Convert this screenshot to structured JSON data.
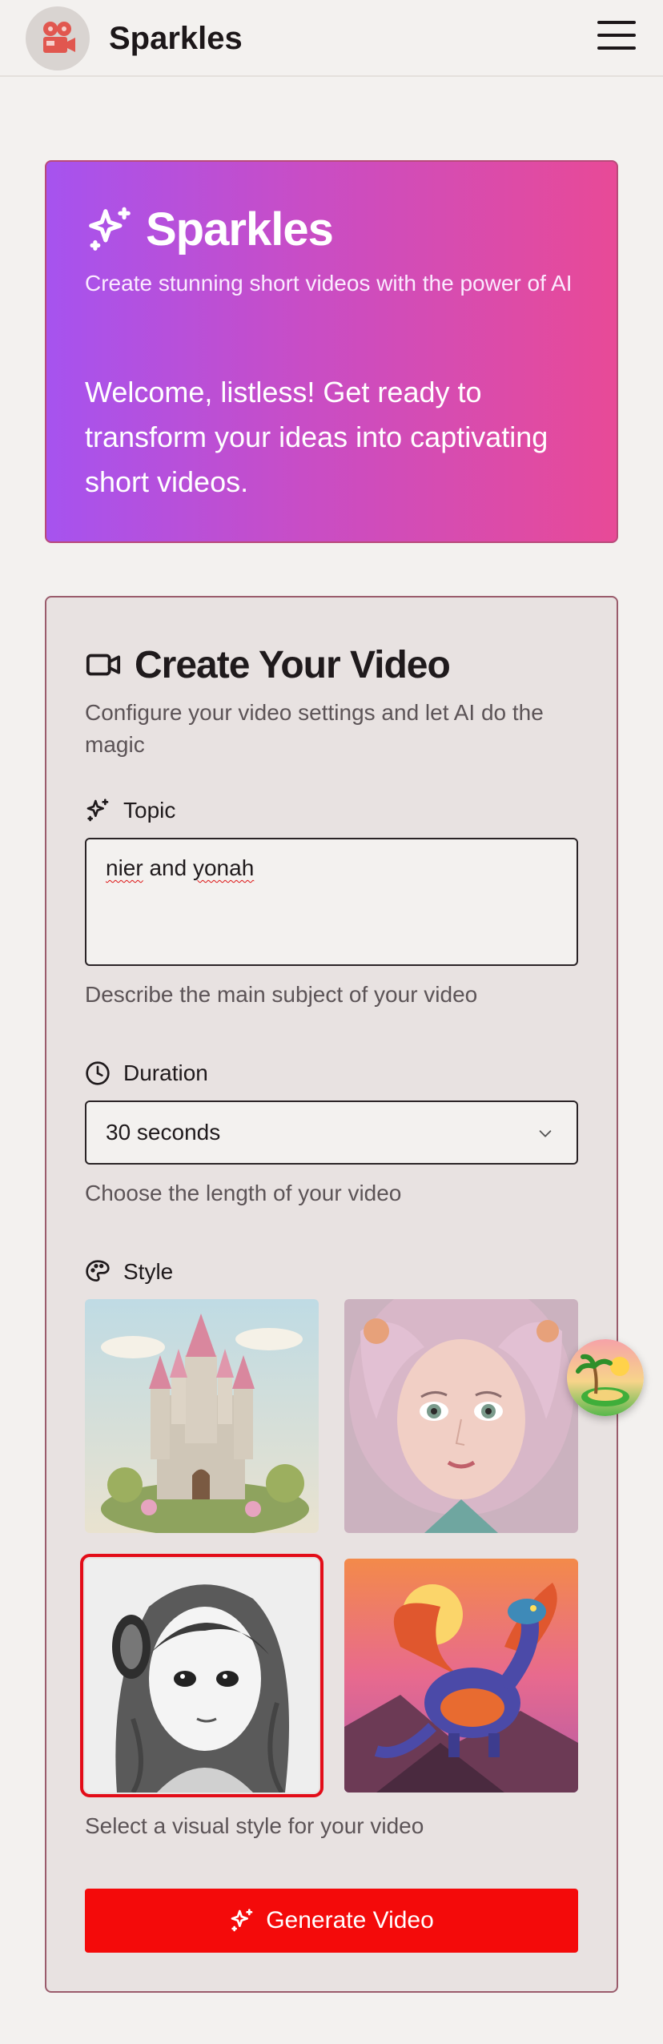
{
  "header": {
    "app_name": "Sparkles"
  },
  "hero": {
    "title": "Sparkles",
    "subtitle": "Create stunning short videos with the power of AI",
    "welcome": "Welcome, listless! Get ready to transform your ideas into captivating short videos."
  },
  "form": {
    "title": "Create Your Video",
    "description": "Configure your video settings and let AI do the magic",
    "topic": {
      "label": "Topic",
      "value_word1": "nier",
      "value_mid": " and ",
      "value_word2": "yonah",
      "help": "Describe the main subject of your video"
    },
    "duration": {
      "label": "Duration",
      "selected": "30 seconds",
      "help": "Choose the length of your video"
    },
    "style": {
      "label": "Style",
      "help": "Select a visual style for your video",
      "options": [
        {
          "name": "fantasy-castle",
          "selected": false
        },
        {
          "name": "realistic-portrait",
          "selected": false
        },
        {
          "name": "sketch-anime",
          "selected": true
        },
        {
          "name": "pixel-dragon",
          "selected": false
        }
      ]
    },
    "generate_label": "Generate Video"
  },
  "colors": {
    "accent": "#f40a0a",
    "hero_gradient_start": "#a653ef",
    "hero_gradient_end": "#e84a97",
    "card_bg": "#e8e2e1"
  }
}
